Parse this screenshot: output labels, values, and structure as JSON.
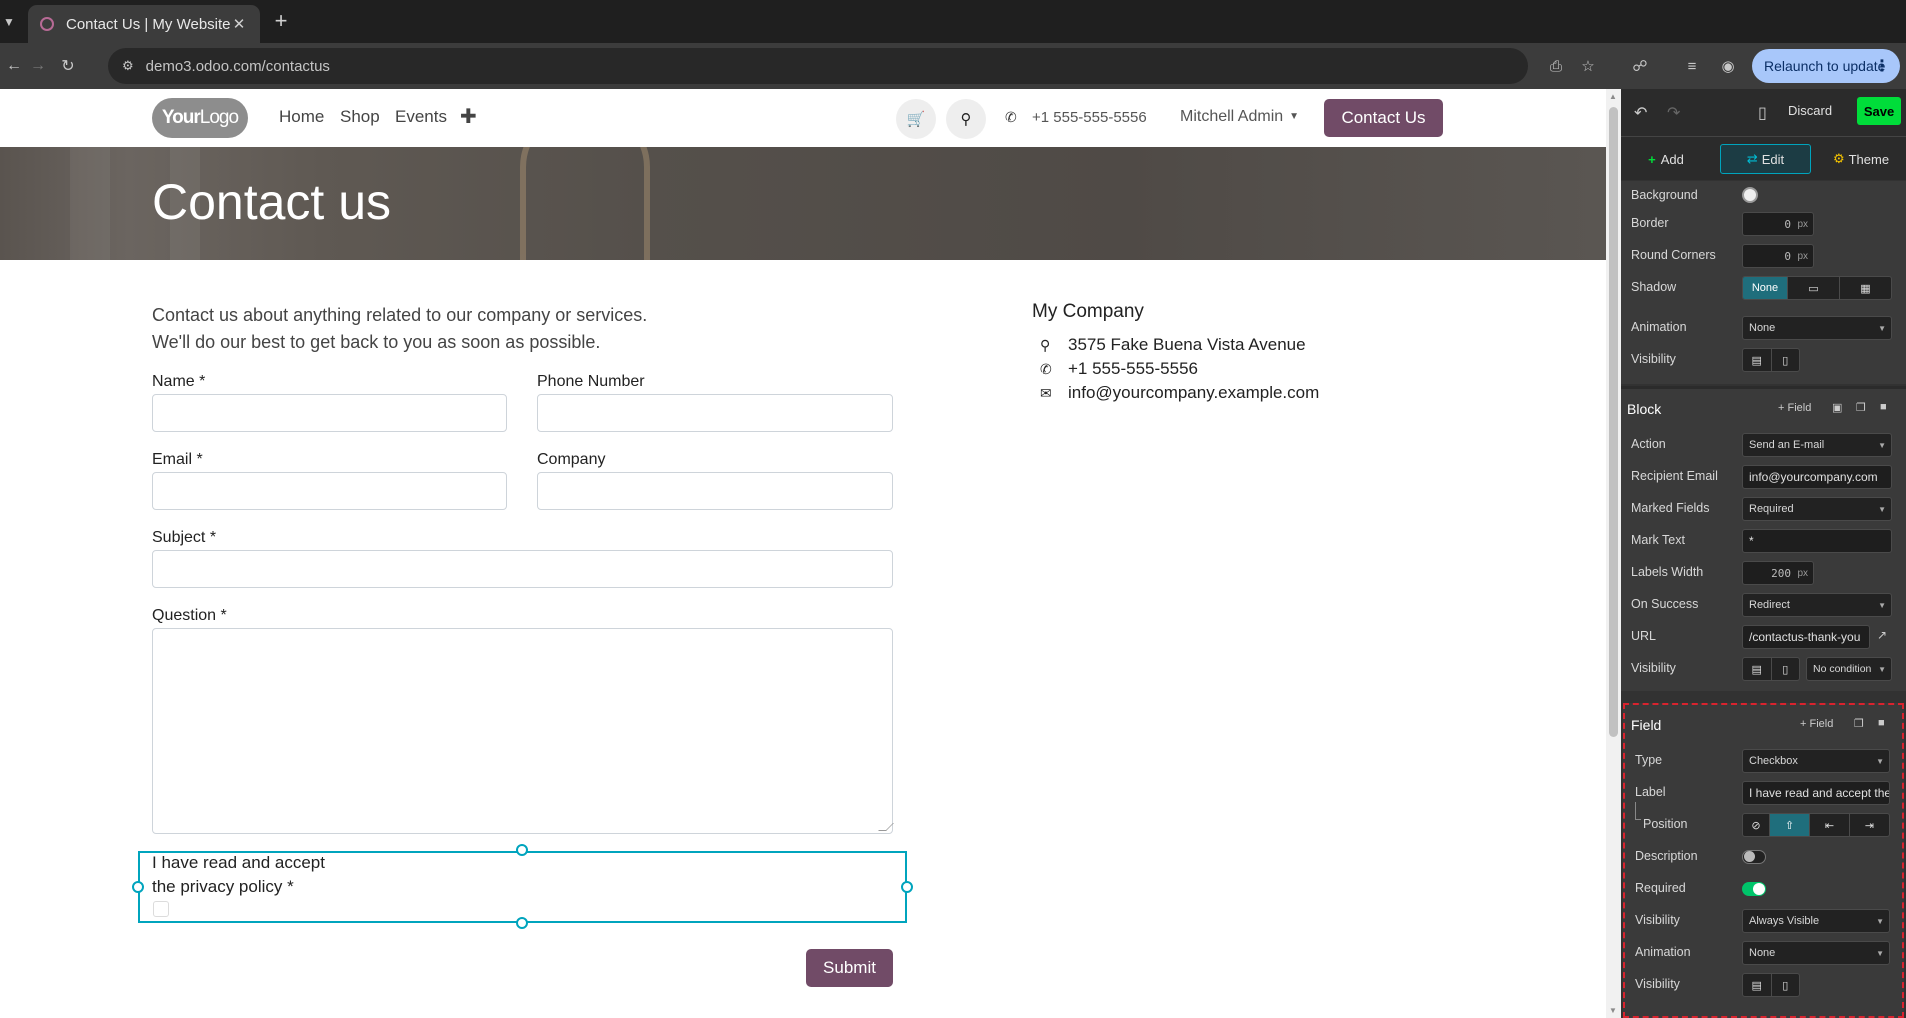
{
  "browser": {
    "tab_title": "Contact Us | My Website",
    "url": "demo3.odoo.com/contactus",
    "relaunch_label": "Relaunch to update"
  },
  "site": {
    "logo": {
      "bold": "Your",
      "light": "Logo"
    },
    "nav": [
      "Home",
      "Shop",
      "Events"
    ],
    "phone": "+1 555-555-5556",
    "user": "Mitchell Admin",
    "cta": "Contact Us",
    "banner_title": "Contact us",
    "intro": [
      "Contact us about anything related to our company or services.",
      "We'll do our best to get back to you as soon as possible."
    ],
    "form": {
      "name_label": "Name *",
      "phone_label": "Phone Number",
      "email_label": "Email *",
      "company_label": "Company",
      "subject_label": "Subject *",
      "question_label": "Question *",
      "privacy_label_1": "I have read and accept",
      "privacy_label_2": "the privacy policy *",
      "submit_label": "Submit"
    },
    "company": {
      "name": "My Company",
      "address": "3575 Fake Buena Vista Avenue",
      "phone": "+1 555-555-5556",
      "email": "info@yourcompany.example.com"
    }
  },
  "editor": {
    "discard": "Discard",
    "save": "Save",
    "tabs": {
      "add": "Add",
      "edit": "Edit",
      "theme": "Theme"
    },
    "style": {
      "background": "Background",
      "border": "Border",
      "border_value": "0",
      "round_corners": "Round Corners",
      "round_value": "0",
      "unit": "px",
      "shadow": "Shadow",
      "shadow_none": "None",
      "animation": "Animation",
      "animation_value": "None",
      "visibility": "Visibility"
    },
    "block": {
      "title": "Block",
      "add_field": "+ Field",
      "action": "Action",
      "action_value": "Send an E-mail",
      "recipient": "Recipient Email",
      "recipient_value": "info@yourcompany.com",
      "marked": "Marked Fields",
      "marked_value": "Required",
      "mark_text": "Mark Text",
      "mark_text_value": "*",
      "labels_width": "Labels Width",
      "labels_width_value": "200",
      "on_success": "On Success",
      "on_success_value": "Redirect",
      "url": "URL",
      "url_value": "/contactus-thank-you",
      "visibility": "Visibility",
      "visibility_value": "No condition"
    },
    "field": {
      "title": "Field",
      "add_field": "+ Field",
      "type": "Type",
      "type_value": "Checkbox",
      "label": "Label",
      "label_value": "I have read and accept the privacy policy",
      "position": "Position",
      "description": "Description",
      "description_on": false,
      "required": "Required",
      "required_on": true,
      "visibility": "Visibility",
      "visibility_value": "Always Visible",
      "animation": "Animation",
      "animation_value": "None",
      "visibility2": "Visibility"
    },
    "colors": {
      "save": "#00dd3a",
      "accent": "#00a4bd",
      "brand": "#714b67",
      "selection_dashed": "#d9232e"
    }
  }
}
